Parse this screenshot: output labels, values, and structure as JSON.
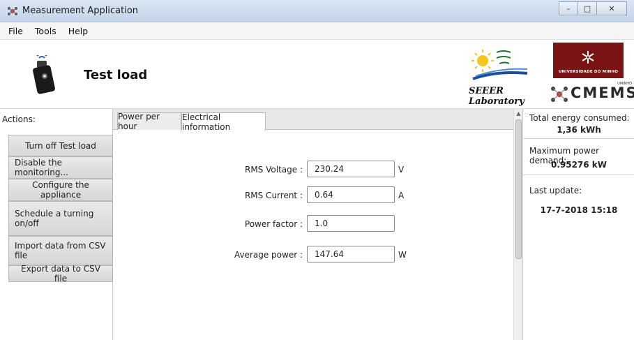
{
  "window": {
    "title": "Measurement Application",
    "controls": {
      "minimize": "–",
      "maximize": "□",
      "close": "✕"
    }
  },
  "menu": [
    "File",
    "Tools",
    "Help"
  ],
  "header": {
    "title": "Test load",
    "device_icon": "wireless-plug-device-icon",
    "seeer_label_line1": "SEEER",
    "seeer_label_line2": "Laboratory",
    "uminho_text": "UNIVERSIDADE DO MINHO",
    "cmems_text": "CMEMS",
    "cmems_top": "UMINHO"
  },
  "actions": {
    "label": "Actions:",
    "buttons": [
      "Turn off Test load",
      "Disable the monitoring...",
      "Configure the appliance",
      "Schedule a turning on/off",
      "Import data from CSV file",
      "Export data to CSV file"
    ]
  },
  "tabs": [
    "Power per hour",
    "Electrical information"
  ],
  "active_tab": "Electrical information",
  "electrical": {
    "rms_voltage": {
      "label": "RMS Voltage :",
      "value": "230.24",
      "unit": "V"
    },
    "rms_current": {
      "label": "RMS Current :",
      "value": "0.64",
      "unit": "A"
    },
    "power_factor": {
      "label": "Power factor :",
      "value": "1.0",
      "unit": ""
    },
    "average_power": {
      "label": "Average power :",
      "value": "147.64",
      "unit": "W"
    }
  },
  "stats": {
    "energy_label": "Total energy consumed:",
    "energy_value": "1,36 kWh",
    "demand_label": "Maximum power demand:",
    "demand_value": "0.95276 kW",
    "update_label": "Last update:",
    "update_value": "17-7-2018 15:18"
  },
  "colors": {
    "uminho_red": "#7a1414",
    "titlebar": "#c3d4ea",
    "button_face": "#dcdcdc"
  }
}
